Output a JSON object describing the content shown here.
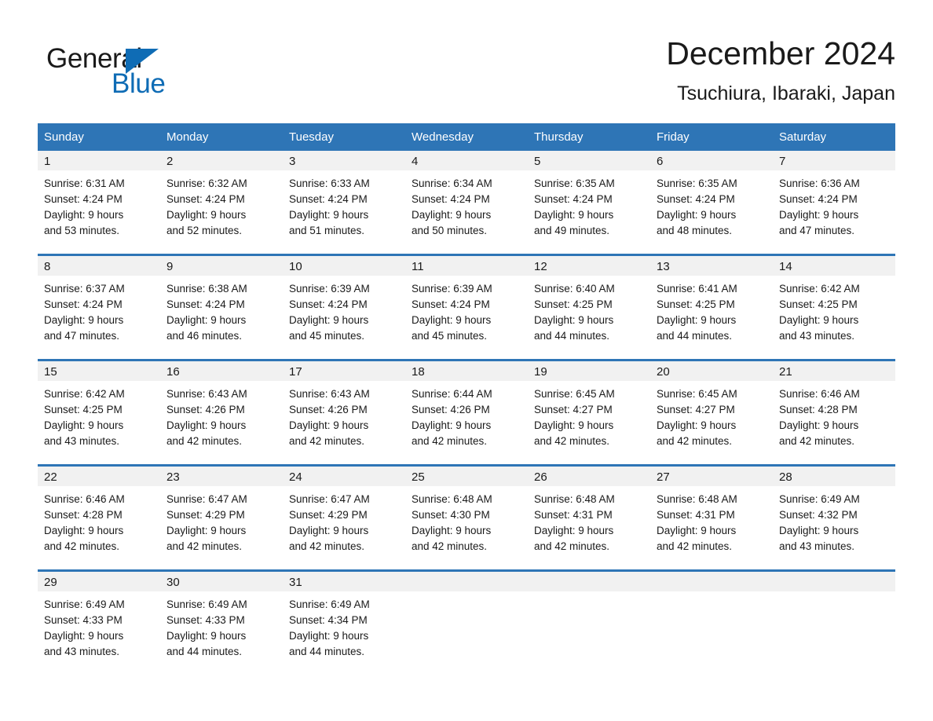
{
  "brand": {
    "name_part1": "General",
    "name_part2": "Blue",
    "accent_color": "#0f6cb5",
    "logo_icon": "triangle-icon"
  },
  "header": {
    "title": "December 2024",
    "subtitle": "Tsuchiura, Ibaraki, Japan"
  },
  "theme": {
    "header_blue": "#2e75b6",
    "row_divider_blue": "#2e75b6",
    "daynum_strip_gray": "#f1f1f1",
    "text_color": "#1a1a1a"
  },
  "calendar": {
    "weekday_headers": [
      "Sunday",
      "Monday",
      "Tuesday",
      "Wednesday",
      "Thursday",
      "Friday",
      "Saturday"
    ],
    "weeks": [
      [
        {
          "day": "1",
          "sunrise": "Sunrise: 6:31 AM",
          "sunset": "Sunset: 4:24 PM",
          "daylight_line1": "Daylight: 9 hours",
          "daylight_line2": "and 53 minutes."
        },
        {
          "day": "2",
          "sunrise": "Sunrise: 6:32 AM",
          "sunset": "Sunset: 4:24 PM",
          "daylight_line1": "Daylight: 9 hours",
          "daylight_line2": "and 52 minutes."
        },
        {
          "day": "3",
          "sunrise": "Sunrise: 6:33 AM",
          "sunset": "Sunset: 4:24 PM",
          "daylight_line1": "Daylight: 9 hours",
          "daylight_line2": "and 51 minutes."
        },
        {
          "day": "4",
          "sunrise": "Sunrise: 6:34 AM",
          "sunset": "Sunset: 4:24 PM",
          "daylight_line1": "Daylight: 9 hours",
          "daylight_line2": "and 50 minutes."
        },
        {
          "day": "5",
          "sunrise": "Sunrise: 6:35 AM",
          "sunset": "Sunset: 4:24 PM",
          "daylight_line1": "Daylight: 9 hours",
          "daylight_line2": "and 49 minutes."
        },
        {
          "day": "6",
          "sunrise": "Sunrise: 6:35 AM",
          "sunset": "Sunset: 4:24 PM",
          "daylight_line1": "Daylight: 9 hours",
          "daylight_line2": "and 48 minutes."
        },
        {
          "day": "7",
          "sunrise": "Sunrise: 6:36 AM",
          "sunset": "Sunset: 4:24 PM",
          "daylight_line1": "Daylight: 9 hours",
          "daylight_line2": "and 47 minutes."
        }
      ],
      [
        {
          "day": "8",
          "sunrise": "Sunrise: 6:37 AM",
          "sunset": "Sunset: 4:24 PM",
          "daylight_line1": "Daylight: 9 hours",
          "daylight_line2": "and 47 minutes."
        },
        {
          "day": "9",
          "sunrise": "Sunrise: 6:38 AM",
          "sunset": "Sunset: 4:24 PM",
          "daylight_line1": "Daylight: 9 hours",
          "daylight_line2": "and 46 minutes."
        },
        {
          "day": "10",
          "sunrise": "Sunrise: 6:39 AM",
          "sunset": "Sunset: 4:24 PM",
          "daylight_line1": "Daylight: 9 hours",
          "daylight_line2": "and 45 minutes."
        },
        {
          "day": "11",
          "sunrise": "Sunrise: 6:39 AM",
          "sunset": "Sunset: 4:24 PM",
          "daylight_line1": "Daylight: 9 hours",
          "daylight_line2": "and 45 minutes."
        },
        {
          "day": "12",
          "sunrise": "Sunrise: 6:40 AM",
          "sunset": "Sunset: 4:25 PM",
          "daylight_line1": "Daylight: 9 hours",
          "daylight_line2": "and 44 minutes."
        },
        {
          "day": "13",
          "sunrise": "Sunrise: 6:41 AM",
          "sunset": "Sunset: 4:25 PM",
          "daylight_line1": "Daylight: 9 hours",
          "daylight_line2": "and 44 minutes."
        },
        {
          "day": "14",
          "sunrise": "Sunrise: 6:42 AM",
          "sunset": "Sunset: 4:25 PM",
          "daylight_line1": "Daylight: 9 hours",
          "daylight_line2": "and 43 minutes."
        }
      ],
      [
        {
          "day": "15",
          "sunrise": "Sunrise: 6:42 AM",
          "sunset": "Sunset: 4:25 PM",
          "daylight_line1": "Daylight: 9 hours",
          "daylight_line2": "and 43 minutes."
        },
        {
          "day": "16",
          "sunrise": "Sunrise: 6:43 AM",
          "sunset": "Sunset: 4:26 PM",
          "daylight_line1": "Daylight: 9 hours",
          "daylight_line2": "and 42 minutes."
        },
        {
          "day": "17",
          "sunrise": "Sunrise: 6:43 AM",
          "sunset": "Sunset: 4:26 PM",
          "daylight_line1": "Daylight: 9 hours",
          "daylight_line2": "and 42 minutes."
        },
        {
          "day": "18",
          "sunrise": "Sunrise: 6:44 AM",
          "sunset": "Sunset: 4:26 PM",
          "daylight_line1": "Daylight: 9 hours",
          "daylight_line2": "and 42 minutes."
        },
        {
          "day": "19",
          "sunrise": "Sunrise: 6:45 AM",
          "sunset": "Sunset: 4:27 PM",
          "daylight_line1": "Daylight: 9 hours",
          "daylight_line2": "and 42 minutes."
        },
        {
          "day": "20",
          "sunrise": "Sunrise: 6:45 AM",
          "sunset": "Sunset: 4:27 PM",
          "daylight_line1": "Daylight: 9 hours",
          "daylight_line2": "and 42 minutes."
        },
        {
          "day": "21",
          "sunrise": "Sunrise: 6:46 AM",
          "sunset": "Sunset: 4:28 PM",
          "daylight_line1": "Daylight: 9 hours",
          "daylight_line2": "and 42 minutes."
        }
      ],
      [
        {
          "day": "22",
          "sunrise": "Sunrise: 6:46 AM",
          "sunset": "Sunset: 4:28 PM",
          "daylight_line1": "Daylight: 9 hours",
          "daylight_line2": "and 42 minutes."
        },
        {
          "day": "23",
          "sunrise": "Sunrise: 6:47 AM",
          "sunset": "Sunset: 4:29 PM",
          "daylight_line1": "Daylight: 9 hours",
          "daylight_line2": "and 42 minutes."
        },
        {
          "day": "24",
          "sunrise": "Sunrise: 6:47 AM",
          "sunset": "Sunset: 4:29 PM",
          "daylight_line1": "Daylight: 9 hours",
          "daylight_line2": "and 42 minutes."
        },
        {
          "day": "25",
          "sunrise": "Sunrise: 6:48 AM",
          "sunset": "Sunset: 4:30 PM",
          "daylight_line1": "Daylight: 9 hours",
          "daylight_line2": "and 42 minutes."
        },
        {
          "day": "26",
          "sunrise": "Sunrise: 6:48 AM",
          "sunset": "Sunset: 4:31 PM",
          "daylight_line1": "Daylight: 9 hours",
          "daylight_line2": "and 42 minutes."
        },
        {
          "day": "27",
          "sunrise": "Sunrise: 6:48 AM",
          "sunset": "Sunset: 4:31 PM",
          "daylight_line1": "Daylight: 9 hours",
          "daylight_line2": "and 42 minutes."
        },
        {
          "day": "28",
          "sunrise": "Sunrise: 6:49 AM",
          "sunset": "Sunset: 4:32 PM",
          "daylight_line1": "Daylight: 9 hours",
          "daylight_line2": "and 43 minutes."
        }
      ],
      [
        {
          "day": "29",
          "sunrise": "Sunrise: 6:49 AM",
          "sunset": "Sunset: 4:33 PM",
          "daylight_line1": "Daylight: 9 hours",
          "daylight_line2": "and 43 minutes."
        },
        {
          "day": "30",
          "sunrise": "Sunrise: 6:49 AM",
          "sunset": "Sunset: 4:33 PM",
          "daylight_line1": "Daylight: 9 hours",
          "daylight_line2": "and 44 minutes."
        },
        {
          "day": "31",
          "sunrise": "Sunrise: 6:49 AM",
          "sunset": "Sunset: 4:34 PM",
          "daylight_line1": "Daylight: 9 hours",
          "daylight_line2": "and 44 minutes."
        },
        {
          "day": "",
          "sunrise": "",
          "sunset": "",
          "daylight_line1": "",
          "daylight_line2": ""
        },
        {
          "day": "",
          "sunrise": "",
          "sunset": "",
          "daylight_line1": "",
          "daylight_line2": ""
        },
        {
          "day": "",
          "sunrise": "",
          "sunset": "",
          "daylight_line1": "",
          "daylight_line2": ""
        },
        {
          "day": "",
          "sunrise": "",
          "sunset": "",
          "daylight_line1": "",
          "daylight_line2": ""
        }
      ]
    ]
  }
}
